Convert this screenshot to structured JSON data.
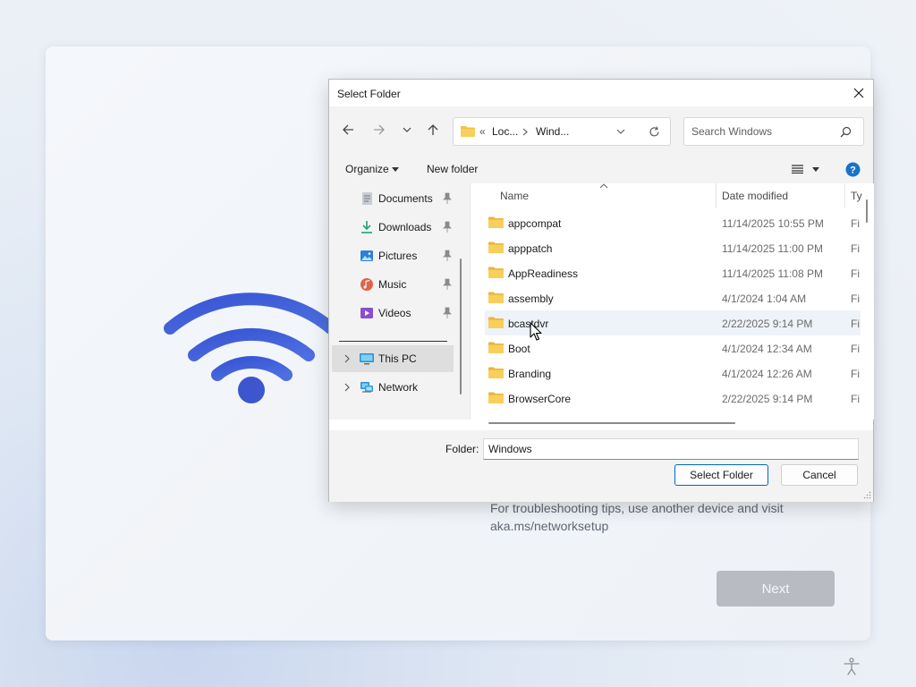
{
  "oobe": {
    "tip_text": "For troubleshooting tips, use another device and visit aka.ms/networksetup",
    "next_label": "Next",
    "accent": "#3f63d6"
  },
  "dialog": {
    "title": "Select Folder",
    "address": {
      "overflow": "«",
      "crumb1": "Loc...",
      "crumb2": "Wind..."
    },
    "search_placeholder": "Search Windows",
    "toolbar": {
      "organize": "Organize",
      "new_folder": "New folder"
    },
    "nav": [
      {
        "label": "Documents",
        "icon": "documents-icon",
        "pinned": true
      },
      {
        "label": "Downloads",
        "icon": "downloads-icon",
        "pinned": true
      },
      {
        "label": "Pictures",
        "icon": "pictures-icon",
        "pinned": true
      },
      {
        "label": "Music",
        "icon": "music-icon",
        "pinned": true
      },
      {
        "label": "Videos",
        "icon": "videos-icon",
        "pinned": true
      },
      {
        "label": "This PC",
        "icon": "this-pc-icon",
        "selected": true
      },
      {
        "label": "Network",
        "icon": "network-icon"
      }
    ],
    "columns": {
      "name": "Name",
      "date": "Date modified",
      "type": "Ty"
    },
    "files": [
      {
        "name": "appcompat",
        "date": "11/14/2025 10:55 PM",
        "type": "Fi"
      },
      {
        "name": "apppatch",
        "date": "11/14/2025 11:00 PM",
        "type": "Fi"
      },
      {
        "name": "AppReadiness",
        "date": "11/14/2025 11:08 PM",
        "type": "Fi"
      },
      {
        "name": "assembly",
        "date": "4/1/2024 1:04 AM",
        "type": "Fi"
      },
      {
        "name": "bcastdvr",
        "date": "2/22/2025 9:14 PM",
        "type": "Fi",
        "hover": true
      },
      {
        "name": "Boot",
        "date": "4/1/2024 12:34 AM",
        "type": "Fi"
      },
      {
        "name": "Branding",
        "date": "4/1/2024 12:26 AM",
        "type": "Fi"
      },
      {
        "name": "BrowserCore",
        "date": "2/22/2025 9:14 PM",
        "type": "Fi"
      }
    ],
    "folder_label": "Folder:",
    "folder_value": "Windows",
    "select_label": "Select Folder",
    "cancel_label": "Cancel"
  }
}
